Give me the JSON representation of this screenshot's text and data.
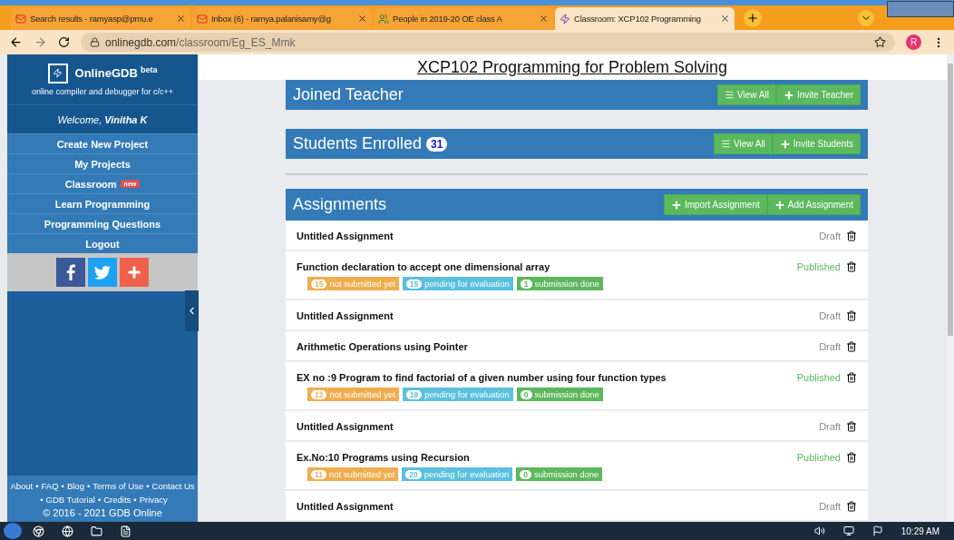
{
  "browser": {
    "tabs": [
      {
        "title": "Search results - ramyasp@pmu.e",
        "kind": "mail",
        "selected": false
      },
      {
        "title": "Inbox (6) - ramya.palanisamy@g",
        "kind": "mail",
        "selected": false
      },
      {
        "title": "People in 2019-20 OE class A",
        "kind": "people",
        "selected": false
      },
      {
        "title": "Classroom: XCP102 Programming",
        "kind": "bolt",
        "selected": true
      }
    ],
    "url_host": "onlinegdb.com",
    "url_path": "/classroom/Eg_ES_Mmk",
    "profile": "R"
  },
  "sidebar": {
    "brand": "OnlineGDB",
    "brand_tag": "beta",
    "tagline": "online compiler and debugger for c/c++",
    "welcome": "Welcome,",
    "user": "Vinitha K",
    "menu": [
      {
        "label": "Create New Project"
      },
      {
        "label": "My Projects"
      },
      {
        "label": "Classroom",
        "badge": "new"
      },
      {
        "label": "Learn Programming"
      },
      {
        "label": "Programming Questions"
      },
      {
        "label": "Logout"
      }
    ],
    "social": [
      {
        "kind": "facebook",
        "color": "#3b5998"
      },
      {
        "kind": "twitter",
        "color": "#1da1f2"
      },
      {
        "kind": "plus",
        "color": "#f0614c"
      }
    ],
    "footer_lines": [
      [
        {
          "label": "About"
        },
        {
          "sep": "•",
          "label": "FAQ"
        },
        {
          "sep": "•",
          "label": "Blog"
        },
        {
          "sep": "•",
          "label": "Terms of Use"
        },
        {
          "sep": "•",
          "label": "Contact Us"
        }
      ],
      [
        {
          "sep": "•",
          "label": "GDB Tutorial"
        },
        {
          "sep": "•",
          "label": "Credits"
        },
        {
          "sep": "•",
          "label": "Privacy"
        }
      ]
    ],
    "copyright": "© 2016 - 2021 GDB Online"
  },
  "page_title": "XCP102 Programming for Problem Solving",
  "sections": [
    {
      "title": "Joined Teacher",
      "buttons": [
        {
          "kind": "list",
          "label": "View All"
        },
        {
          "kind": "add",
          "label": "Invite Teacher"
        }
      ]
    },
    {
      "title": "Students Enrolled",
      "count": "31",
      "buttons": [
        {
          "kind": "list",
          "label": "View All"
        },
        {
          "kind": "add",
          "label": "Invite Students"
        }
      ]
    }
  ],
  "assignments": {
    "title": "Assignments",
    "buttons": [
      {
        "kind": "add",
        "label": "Import Assignment"
      },
      {
        "kind": "add",
        "label": "Add Assignment"
      }
    ],
    "rows": [
      {
        "title": "Untitled Assignment",
        "status": "Draft",
        "kind": "draft"
      },
      {
        "title": "Function declaration to accept one dimensional array",
        "status": "Published",
        "kind": "published",
        "stats": [
          {
            "count": "15",
            "label": "not submitted yet",
            "color": "#f0ad4e"
          },
          {
            "count": "15",
            "label": "pending for evaluation",
            "color": "#5bc0de"
          },
          {
            "count": "1",
            "label": "submission done",
            "color": "#5cb85c"
          }
        ]
      },
      {
        "title": "Untitled Assignment",
        "status": "Draft",
        "kind": "draft"
      },
      {
        "title": "Arithmetic Operations using Pointer",
        "status": "Draft",
        "kind": "draft"
      },
      {
        "title": "EX no :9 Program to find factorial of a given number using four function types",
        "status": "Published",
        "kind": "published",
        "stats": [
          {
            "count": "12",
            "label": "not submitted yet",
            "color": "#f0ad4e"
          },
          {
            "count": "19",
            "label": "pending for evaluation",
            "color": "#5bc0de"
          },
          {
            "count": "0",
            "label": "submission done",
            "color": "#5cb85c"
          }
        ]
      },
      {
        "title": "Untitled Assignment",
        "status": "Draft",
        "kind": "draft"
      },
      {
        "title": "Ex.No:10 Programs using Recursion",
        "status": "Published",
        "kind": "published",
        "stats": [
          {
            "count": "11",
            "label": "not submitted yet",
            "color": "#f0ad4e"
          },
          {
            "count": "20",
            "label": "pending for evaluation",
            "color": "#5bc0de"
          },
          {
            "count": "0",
            "label": "submission done",
            "color": "#5cb85c"
          }
        ]
      },
      {
        "title": "Untitled Assignment",
        "status": "Draft",
        "kind": "draft"
      }
    ]
  },
  "taskbar": {
    "time": "10:29 AM"
  }
}
